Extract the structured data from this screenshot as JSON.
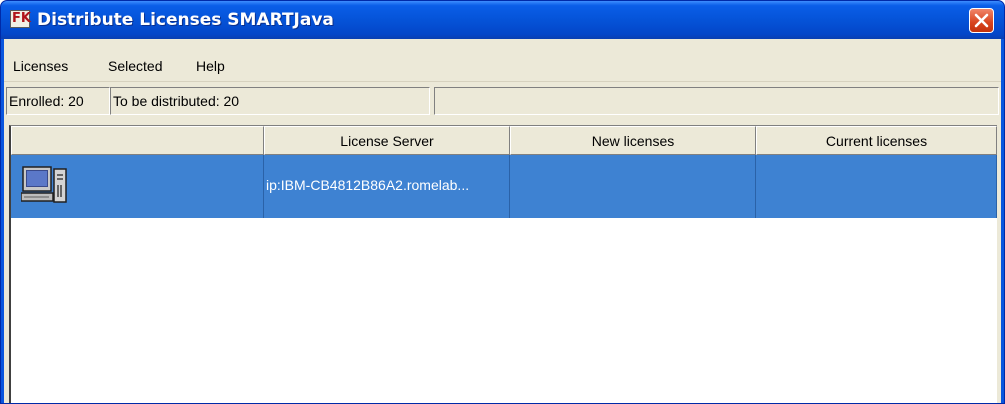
{
  "window": {
    "title": "Distribute Licenses SMARTJava",
    "app_icon_glyph": "FK",
    "app_icon": "license-app-icon",
    "close_icon": "close-icon",
    "titlebar_color": "#0553d8",
    "close_color": "#d8431d"
  },
  "menu": {
    "items": [
      {
        "label": "Licenses"
      },
      {
        "label": "Selected"
      },
      {
        "label": "Help"
      }
    ]
  },
  "status": {
    "enrolled": "Enrolled: 20",
    "to_be_distributed": "To be distributed: 20"
  },
  "table": {
    "columns": [
      "",
      "License Server",
      "New licenses",
      "Current licenses"
    ],
    "rows": [
      {
        "icon": "computer-icon",
        "license_server": "ip:IBM-CB4812B86A2.romelab...",
        "new_licenses": "",
        "current_licenses": ""
      }
    ],
    "selection_color": "#3e82d2"
  }
}
